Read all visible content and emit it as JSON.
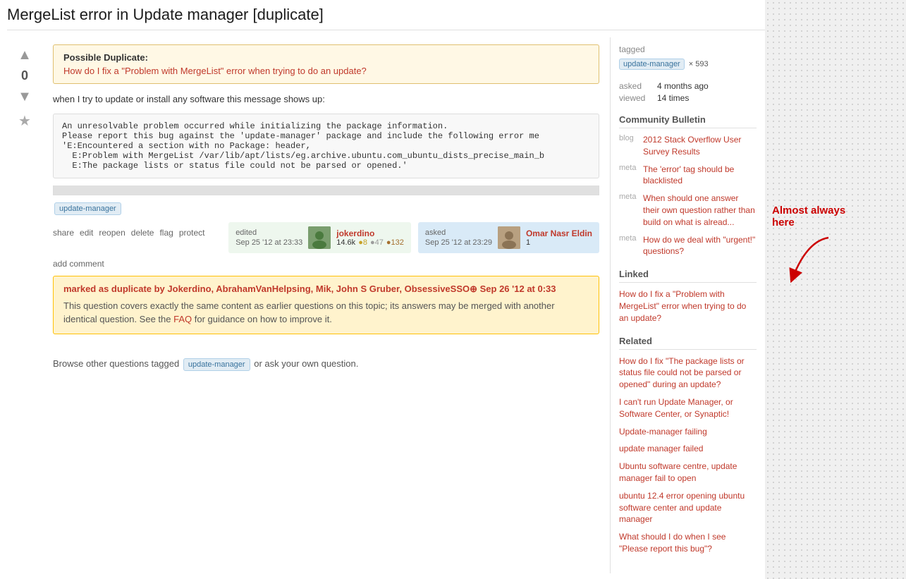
{
  "page": {
    "title": "MergeList error in Update manager [duplicate]",
    "background_right": "dotted"
  },
  "question": {
    "title": "MergeList error in Update manager [duplicate]",
    "vote_count": "0",
    "possible_duplicate_label": "Possible Duplicate:",
    "possible_duplicate_link": "How do I fix a \"Problem with MergeList\" error when trying to do an update?",
    "body_text": "when I try to update or install any software this message shows up:",
    "code_block": "An unresolvable problem occurred while initializing the package information.\nPlease report this bug against the 'update-manager' package and include the following error me\n'E:Encountered a section with no Package: header,\n  E:Problem with MergeList /var/lib/apt/lists/eg.archive.ubuntu.com_ubuntu_dists_precise_main_b\n  E:The package lists or status file could not be parsed or opened.'",
    "tag": "update-manager",
    "actions": [
      "share",
      "edit",
      "reopen",
      "delete",
      "flag",
      "protect"
    ],
    "edited_label": "edited",
    "edited_time": "Sep 25 '12 at 23:33",
    "asked_label": "asked",
    "asked_time": "Sep 25 '12 at 23:29",
    "editor": {
      "name": "jokerdino",
      "rep": "14.6k",
      "badges": {
        "gold": "8",
        "silver": "47",
        "bronze": "132"
      }
    },
    "asker": {
      "name": "Omar Nasr Eldin",
      "rep": "1"
    },
    "add_comment": "add comment",
    "duplicate_notice": {
      "header_text": "marked as duplicate by",
      "users": [
        "Jokerdino",
        "AbrahamVanHelpsing",
        "Mik",
        "John S Gruber",
        "ObsessiveSSO⊕"
      ],
      "timestamp": "Sep 26 '12 at 0:33",
      "body": "This question covers exactly the same content as earlier questions on this topic; its answers may be merged with another identical question. See the",
      "faq_link": "FAQ",
      "body2": "for guidance on how to improve it."
    }
  },
  "browse_section": {
    "prefix": "Browse other questions tagged",
    "tag": "update-manager",
    "suffix": "or ask your own question."
  },
  "sidebar": {
    "tagged_label": "tagged",
    "tag_name": "update-manager",
    "tag_count": "× 593",
    "asked_label": "asked",
    "asked_value": "4 months ago",
    "viewed_label": "viewed",
    "viewed_value": "14 times",
    "community_bulletin": {
      "title": "Community Bulletin",
      "items": [
        {
          "type": "blog",
          "text": "2012 Stack Overflow User Survey Results",
          "is_link": true
        },
        {
          "type": "meta",
          "text": "The 'error' tag should be blacklisted",
          "is_link": true
        },
        {
          "type": "meta",
          "text": "When should one answer their own question rather than build on what is alread...",
          "is_link": true
        },
        {
          "type": "meta",
          "text": "How do we deal with \"urgent!\" questions?",
          "is_link": true
        }
      ]
    },
    "linked": {
      "title": "Linked",
      "items": [
        {
          "text": "How do I fix a \"Problem with MergeList\" error when trying to do an update?"
        }
      ]
    },
    "related": {
      "title": "Related",
      "items": [
        {
          "text": "How do I fix \"The package lists or status file could not be parsed or opened\" during an update?"
        },
        {
          "text": "I can't run Update Manager, or Software Center, or Synaptic!"
        },
        {
          "text": "Update-manager failing"
        },
        {
          "text": "update manager failed"
        },
        {
          "text": "Ubuntu software centre, update manager fail to open"
        },
        {
          "text": "ubuntu 12.4 error opening ubuntu software center and update manager"
        },
        {
          "text": "What should I do when I see \"Please report this bug\"?"
        }
      ]
    }
  },
  "annotation": {
    "text": "Almost always here",
    "arrow_direction": "down-left"
  }
}
